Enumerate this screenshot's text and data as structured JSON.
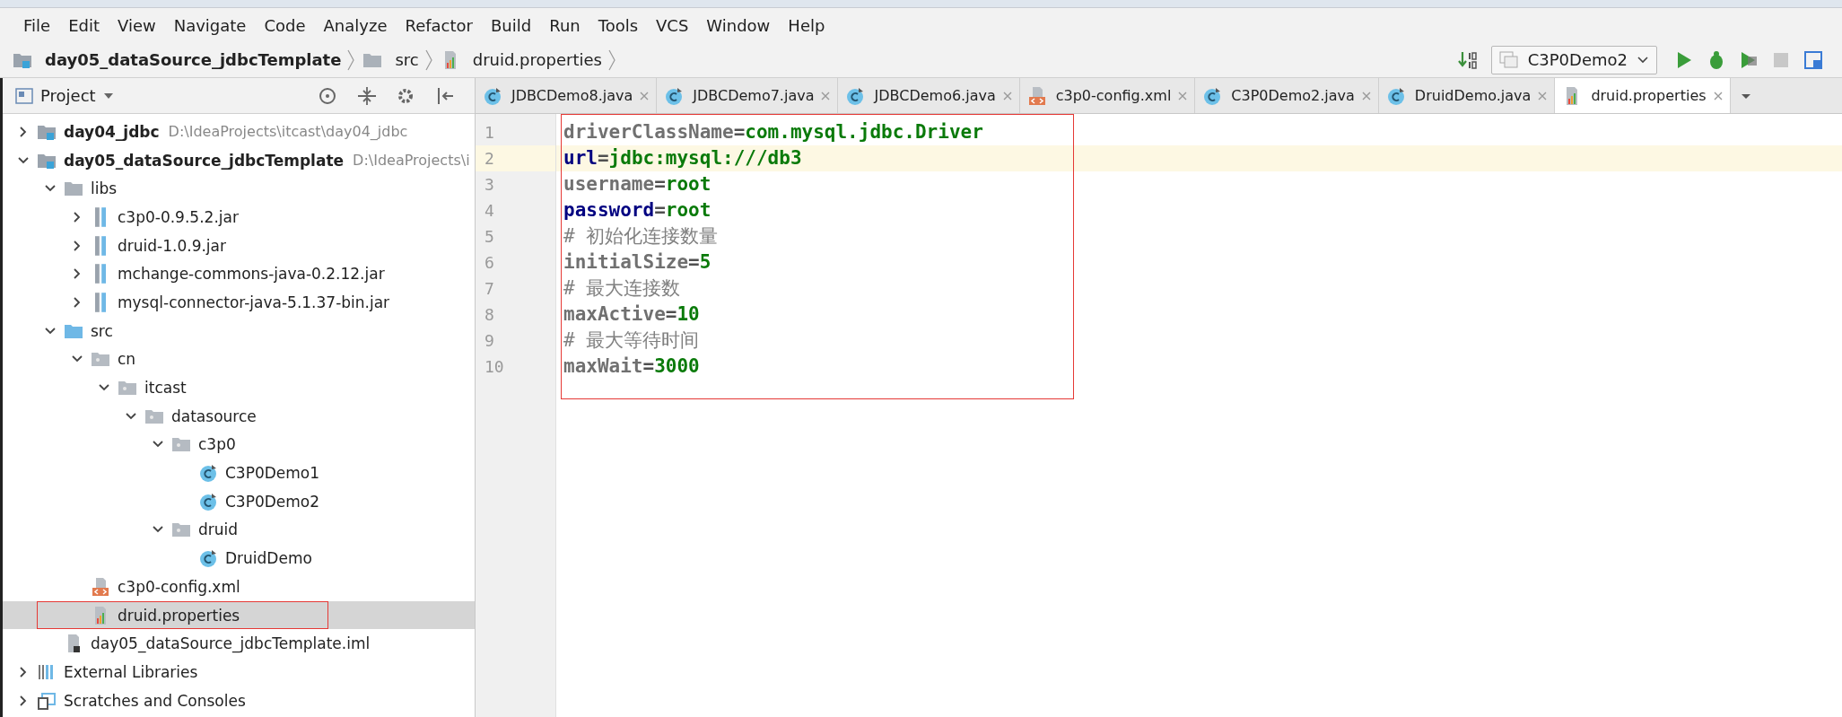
{
  "menu": [
    "File",
    "Edit",
    "View",
    "Navigate",
    "Code",
    "Analyze",
    "Refactor",
    "Build",
    "Run",
    "Tools",
    "VCS",
    "Window",
    "Help"
  ],
  "breadcrumbs": [
    {
      "kind": "module",
      "label": "day05_dataSource_jdbcTemplate"
    },
    {
      "kind": "folder",
      "label": "src"
    },
    {
      "kind": "properties",
      "label": "druid.properties"
    }
  ],
  "run_config": {
    "label": "C3P0Demo2"
  },
  "project_panel": {
    "title": "Project"
  },
  "tree": [
    {
      "kind": "module",
      "label": "day04_jdbc",
      "path": "D:\\IdeaProjects\\itcast\\day04_jdbc",
      "expanded": false,
      "selected": false
    },
    {
      "kind": "module",
      "label": "day05_dataSource_jdbcTemplate",
      "path": "D:\\IdeaProjects\\i",
      "expanded": true,
      "selected": false,
      "children": [
        {
          "kind": "folder",
          "label": "libs",
          "expanded": true,
          "selected": false,
          "children": [
            {
              "kind": "jar",
              "label": "c3p0-0.9.5.2.jar",
              "expanded": false,
              "selected": false
            },
            {
              "kind": "jar",
              "label": "druid-1.0.9.jar",
              "expanded": false,
              "selected": false
            },
            {
              "kind": "jar",
              "label": "mchange-commons-java-0.2.12.jar",
              "expanded": false,
              "selected": false
            },
            {
              "kind": "jar",
              "label": "mysql-connector-java-5.1.37-bin.jar",
              "expanded": false,
              "selected": false
            }
          ]
        },
        {
          "kind": "source",
          "label": "src",
          "expanded": true,
          "selected": false,
          "children": [
            {
              "kind": "package",
              "label": "cn",
              "expanded": true,
              "selected": false,
              "children": [
                {
                  "kind": "package",
                  "label": "itcast",
                  "expanded": true,
                  "selected": false,
                  "children": [
                    {
                      "kind": "package",
                      "label": "datasource",
                      "expanded": true,
                      "selected": false,
                      "children": [
                        {
                          "kind": "package",
                          "label": "c3p0",
                          "expanded": true,
                          "selected": false,
                          "children": [
                            {
                              "kind": "class",
                              "label": "C3P0Demo1",
                              "selected": false
                            },
                            {
                              "kind": "class",
                              "label": "C3P0Demo2",
                              "selected": false
                            }
                          ]
                        },
                        {
                          "kind": "package",
                          "label": "druid",
                          "expanded": true,
                          "selected": false,
                          "children": [
                            {
                              "kind": "class",
                              "label": "DruidDemo",
                              "selected": false
                            }
                          ]
                        }
                      ]
                    }
                  ]
                }
              ]
            },
            {
              "kind": "xml",
              "label": "c3p0-config.xml",
              "selected": false
            },
            {
              "kind": "properties",
              "label": "druid.properties",
              "selected": true,
              "highlighted": true
            }
          ]
        },
        {
          "kind": "iml",
          "label": "day05_dataSource_jdbcTemplate.iml",
          "selected": false
        }
      ]
    },
    {
      "kind": "libraries",
      "label": "External Libraries",
      "expanded": false,
      "selected": false
    },
    {
      "kind": "scratches",
      "label": "Scratches and Consoles",
      "expanded": false,
      "selected": false
    }
  ],
  "tabs": [
    {
      "kind": "class",
      "label": "JDBCDemo8.java",
      "selected": false
    },
    {
      "kind": "class",
      "label": "JDBCDemo7.java",
      "selected": false
    },
    {
      "kind": "class",
      "label": "JDBCDemo6.java",
      "selected": false
    },
    {
      "kind": "xml",
      "label": "c3p0-config.xml",
      "selected": false
    },
    {
      "kind": "class",
      "label": "C3P0Demo2.java",
      "selected": false
    },
    {
      "kind": "class",
      "label": "DruidDemo.java",
      "selected": false
    },
    {
      "kind": "properties",
      "label": "druid.properties",
      "selected": true
    }
  ],
  "editor": {
    "highlighted": true,
    "lines": [
      {
        "number": "1",
        "kind": "property",
        "key": "driverClassName",
        "separator": "=",
        "value": "com.mysql.jdbc.Driver",
        "key_known": false,
        "current": false
      },
      {
        "number": "2",
        "kind": "property",
        "key": "url",
        "separator": "=",
        "value": "jdbc:mysql:///db3",
        "key_known": true,
        "current": true
      },
      {
        "number": "3",
        "kind": "property",
        "key": "username",
        "separator": "=",
        "value": "root",
        "key_known": false,
        "current": false
      },
      {
        "number": "4",
        "kind": "property",
        "key": "password",
        "separator": "=",
        "value": "root",
        "key_known": true,
        "current": false
      },
      {
        "number": "5",
        "kind": "comment",
        "text": "# 初始化连接数量",
        "current": false
      },
      {
        "number": "6",
        "kind": "property",
        "key": "initialSize",
        "separator": "=",
        "value": "5",
        "key_known": false,
        "current": false
      },
      {
        "number": "7",
        "kind": "comment",
        "text": "# 最大连接数",
        "current": false
      },
      {
        "number": "8",
        "kind": "property",
        "key": "maxActive",
        "separator": "=",
        "value": "10",
        "key_known": false,
        "current": false
      },
      {
        "number": "9",
        "kind": "comment",
        "text": "# 最大等待时间",
        "current": false
      },
      {
        "number": "10",
        "kind": "property",
        "key": "maxWait",
        "separator": "=",
        "value": "3000",
        "key_known": false,
        "current": false
      }
    ]
  }
}
